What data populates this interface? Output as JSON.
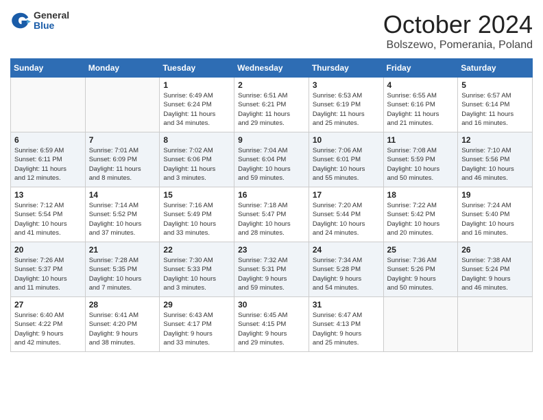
{
  "header": {
    "logo_general": "General",
    "logo_blue": "Blue",
    "month": "October 2024",
    "location": "Bolszewo, Pomerania, Poland"
  },
  "weekdays": [
    "Sunday",
    "Monday",
    "Tuesday",
    "Wednesday",
    "Thursday",
    "Friday",
    "Saturday"
  ],
  "weeks": [
    [
      {
        "day": "",
        "info": ""
      },
      {
        "day": "",
        "info": ""
      },
      {
        "day": "1",
        "info": "Sunrise: 6:49 AM\nSunset: 6:24 PM\nDaylight: 11 hours\nand 34 minutes."
      },
      {
        "day": "2",
        "info": "Sunrise: 6:51 AM\nSunset: 6:21 PM\nDaylight: 11 hours\nand 29 minutes."
      },
      {
        "day": "3",
        "info": "Sunrise: 6:53 AM\nSunset: 6:19 PM\nDaylight: 11 hours\nand 25 minutes."
      },
      {
        "day": "4",
        "info": "Sunrise: 6:55 AM\nSunset: 6:16 PM\nDaylight: 11 hours\nand 21 minutes."
      },
      {
        "day": "5",
        "info": "Sunrise: 6:57 AM\nSunset: 6:14 PM\nDaylight: 11 hours\nand 16 minutes."
      }
    ],
    [
      {
        "day": "6",
        "info": "Sunrise: 6:59 AM\nSunset: 6:11 PM\nDaylight: 11 hours\nand 12 minutes."
      },
      {
        "day": "7",
        "info": "Sunrise: 7:01 AM\nSunset: 6:09 PM\nDaylight: 11 hours\nand 8 minutes."
      },
      {
        "day": "8",
        "info": "Sunrise: 7:02 AM\nSunset: 6:06 PM\nDaylight: 11 hours\nand 3 minutes."
      },
      {
        "day": "9",
        "info": "Sunrise: 7:04 AM\nSunset: 6:04 PM\nDaylight: 10 hours\nand 59 minutes."
      },
      {
        "day": "10",
        "info": "Sunrise: 7:06 AM\nSunset: 6:01 PM\nDaylight: 10 hours\nand 55 minutes."
      },
      {
        "day": "11",
        "info": "Sunrise: 7:08 AM\nSunset: 5:59 PM\nDaylight: 10 hours\nand 50 minutes."
      },
      {
        "day": "12",
        "info": "Sunrise: 7:10 AM\nSunset: 5:56 PM\nDaylight: 10 hours\nand 46 minutes."
      }
    ],
    [
      {
        "day": "13",
        "info": "Sunrise: 7:12 AM\nSunset: 5:54 PM\nDaylight: 10 hours\nand 41 minutes."
      },
      {
        "day": "14",
        "info": "Sunrise: 7:14 AM\nSunset: 5:52 PM\nDaylight: 10 hours\nand 37 minutes."
      },
      {
        "day": "15",
        "info": "Sunrise: 7:16 AM\nSunset: 5:49 PM\nDaylight: 10 hours\nand 33 minutes."
      },
      {
        "day": "16",
        "info": "Sunrise: 7:18 AM\nSunset: 5:47 PM\nDaylight: 10 hours\nand 28 minutes."
      },
      {
        "day": "17",
        "info": "Sunrise: 7:20 AM\nSunset: 5:44 PM\nDaylight: 10 hours\nand 24 minutes."
      },
      {
        "day": "18",
        "info": "Sunrise: 7:22 AM\nSunset: 5:42 PM\nDaylight: 10 hours\nand 20 minutes."
      },
      {
        "day": "19",
        "info": "Sunrise: 7:24 AM\nSunset: 5:40 PM\nDaylight: 10 hours\nand 16 minutes."
      }
    ],
    [
      {
        "day": "20",
        "info": "Sunrise: 7:26 AM\nSunset: 5:37 PM\nDaylight: 10 hours\nand 11 minutes."
      },
      {
        "day": "21",
        "info": "Sunrise: 7:28 AM\nSunset: 5:35 PM\nDaylight: 10 hours\nand 7 minutes."
      },
      {
        "day": "22",
        "info": "Sunrise: 7:30 AM\nSunset: 5:33 PM\nDaylight: 10 hours\nand 3 minutes."
      },
      {
        "day": "23",
        "info": "Sunrise: 7:32 AM\nSunset: 5:31 PM\nDaylight: 9 hours\nand 59 minutes."
      },
      {
        "day": "24",
        "info": "Sunrise: 7:34 AM\nSunset: 5:28 PM\nDaylight: 9 hours\nand 54 minutes."
      },
      {
        "day": "25",
        "info": "Sunrise: 7:36 AM\nSunset: 5:26 PM\nDaylight: 9 hours\nand 50 minutes."
      },
      {
        "day": "26",
        "info": "Sunrise: 7:38 AM\nSunset: 5:24 PM\nDaylight: 9 hours\nand 46 minutes."
      }
    ],
    [
      {
        "day": "27",
        "info": "Sunrise: 6:40 AM\nSunset: 4:22 PM\nDaylight: 9 hours\nand 42 minutes."
      },
      {
        "day": "28",
        "info": "Sunrise: 6:41 AM\nSunset: 4:20 PM\nDaylight: 9 hours\nand 38 minutes."
      },
      {
        "day": "29",
        "info": "Sunrise: 6:43 AM\nSunset: 4:17 PM\nDaylight: 9 hours\nand 33 minutes."
      },
      {
        "day": "30",
        "info": "Sunrise: 6:45 AM\nSunset: 4:15 PM\nDaylight: 9 hours\nand 29 minutes."
      },
      {
        "day": "31",
        "info": "Sunrise: 6:47 AM\nSunset: 4:13 PM\nDaylight: 9 hours\nand 25 minutes."
      },
      {
        "day": "",
        "info": ""
      },
      {
        "day": "",
        "info": ""
      }
    ]
  ]
}
